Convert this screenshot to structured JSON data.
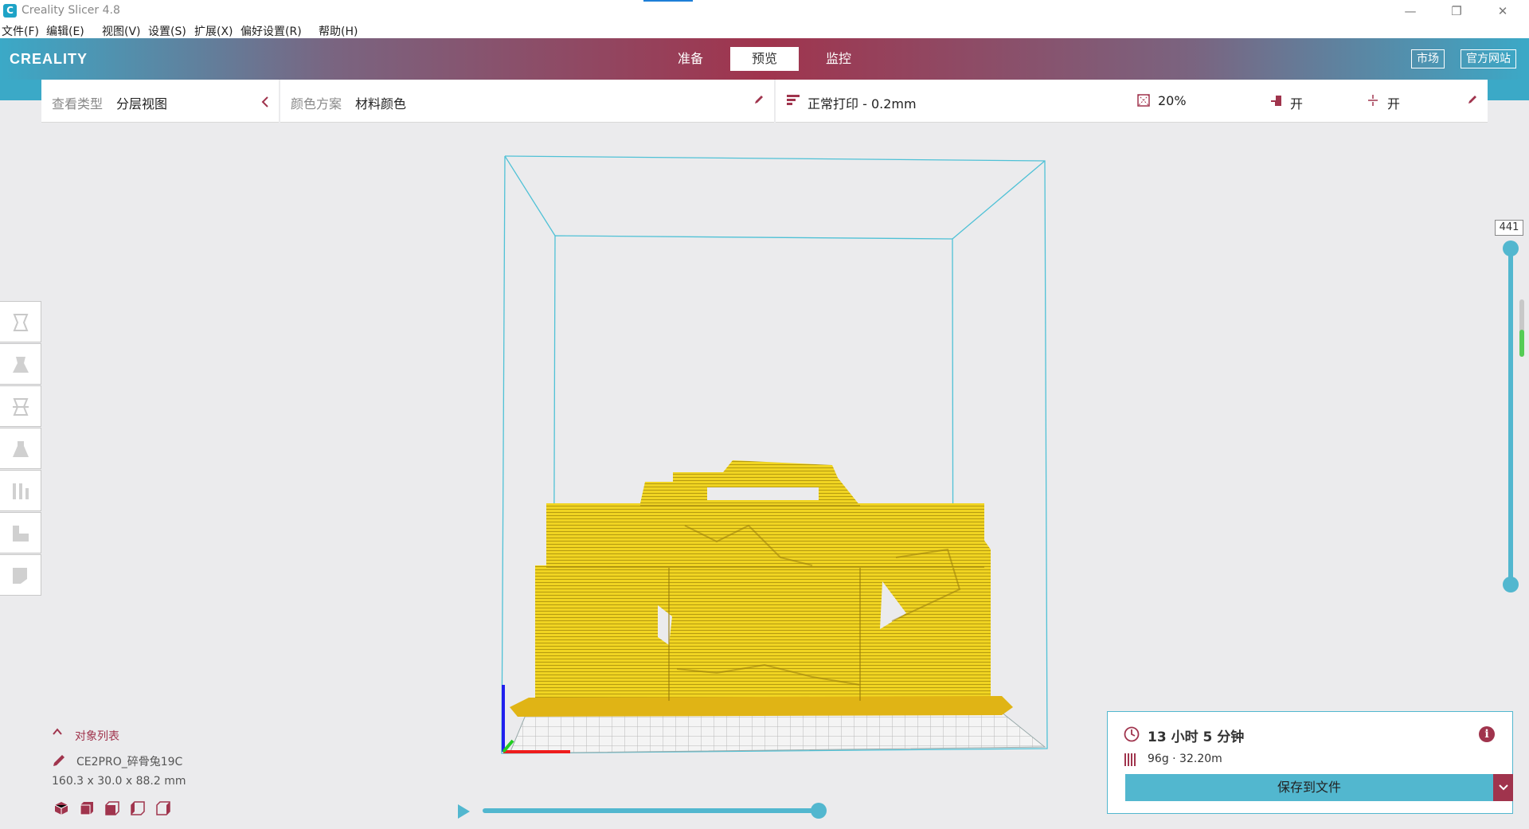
{
  "window": {
    "title": "Creality Slicer 4.8",
    "controls": [
      "—",
      "❐",
      "✕"
    ]
  },
  "menu": [
    "文件(F)",
    "编辑(E)",
    "视图(V)",
    "设置(S)",
    "扩展(X)",
    "偏好设置(R)",
    "帮助(H)"
  ],
  "header": {
    "brand": "CREALITY",
    "tabs": [
      "准备",
      "预览",
      "监控"
    ],
    "active_tab": "预览",
    "market_button": "市场",
    "website_button": "官方网站"
  },
  "view_panel": {
    "type_label": "查看类型",
    "type_value": "分层视图",
    "color_label": "颜色方案",
    "color_value": "材料颜色"
  },
  "print_settings": {
    "profile": "正常打印 - 0.2mm",
    "infill": "20%",
    "support": "开",
    "adhesion": "开"
  },
  "layer_slider": {
    "current_layer": "441",
    "level": 1.0
  },
  "playback": {
    "progress": 1.0
  },
  "object_list": {
    "title": "对象列表",
    "name": "CE2PRO_碎骨兔19C",
    "dimensions": "160.3 x 30.0 x 88.2 mm"
  },
  "summary": {
    "time": "13 小时 5 分钟",
    "material": "96g · 32.20m",
    "save_button": "保存到文件"
  },
  "colors": {
    "accent": "#52b7cf",
    "brand_red": "#a0344d",
    "model": "#f2da2a"
  }
}
